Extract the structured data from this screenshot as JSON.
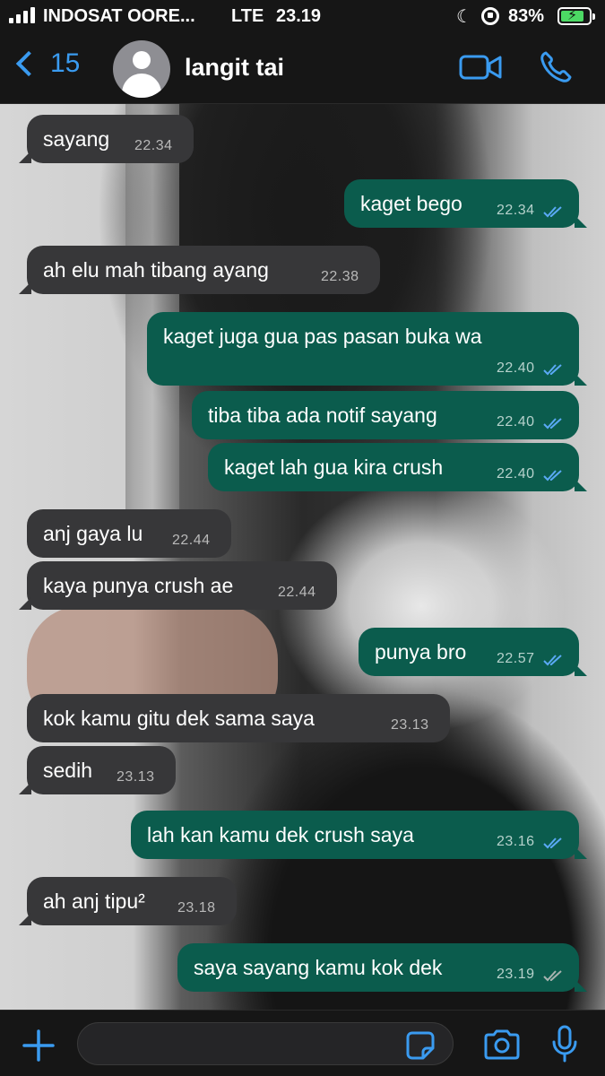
{
  "status_bar": {
    "carrier": "INDOSAT OORE...",
    "network": "LTE",
    "time": "23.19",
    "battery": "83%",
    "battery_level": 0.83
  },
  "header": {
    "back_count": "15",
    "contact_name": "langit tai",
    "icons": [
      "chevron-left-icon",
      "avatar-placeholder-icon",
      "video-call-icon",
      "phone-call-icon"
    ]
  },
  "messages": [
    {
      "dir": "in",
      "text": "sayang",
      "time": "22.34"
    },
    {
      "dir": "out",
      "text": "kaget bego",
      "time": "22.34",
      "status": "read"
    },
    {
      "dir": "in",
      "text": "ah elu mah tibang ayang",
      "time": "22.38"
    },
    {
      "dir": "out",
      "text": "kaget juga gua pas pasan buka wa",
      "time": "22.40",
      "status": "read"
    },
    {
      "dir": "out",
      "text": "tiba tiba ada notif sayang",
      "time": "22.40",
      "status": "read"
    },
    {
      "dir": "out",
      "text": "kaget lah gua kira crush",
      "time": "22.40",
      "status": "read"
    },
    {
      "dir": "in",
      "text": "anj gaya lu",
      "time": "22.44"
    },
    {
      "dir": "in",
      "text": "kaya punya crush ae",
      "time": "22.44"
    },
    {
      "dir": "out",
      "text": "punya bro",
      "time": "22.57",
      "status": "read"
    },
    {
      "dir": "in",
      "text": "kok kamu gitu dek sama saya",
      "time": "23.13"
    },
    {
      "dir": "in",
      "text": "sedih",
      "time": "23.13"
    },
    {
      "dir": "out",
      "text": "lah kan kamu dek crush saya",
      "time": "23.16",
      "status": "read"
    },
    {
      "dir": "in",
      "text": "ah anj tipu²",
      "time": "23.18"
    },
    {
      "dir": "out",
      "text": "saya sayang kamu kok dek",
      "time": "23.19",
      "status": "delivered"
    }
  ],
  "input_bar": {
    "placeholder": "",
    "icons": [
      "plus-icon",
      "sticker-icon",
      "camera-icon",
      "microphone-icon"
    ]
  },
  "colors": {
    "accent": "#3a9bf0",
    "incoming_bubble": "#373739",
    "outgoing_bubble": "#0b5c4d",
    "read_ticks": "#5aa9f5",
    "delivered_ticks": "#a8b3b0"
  }
}
